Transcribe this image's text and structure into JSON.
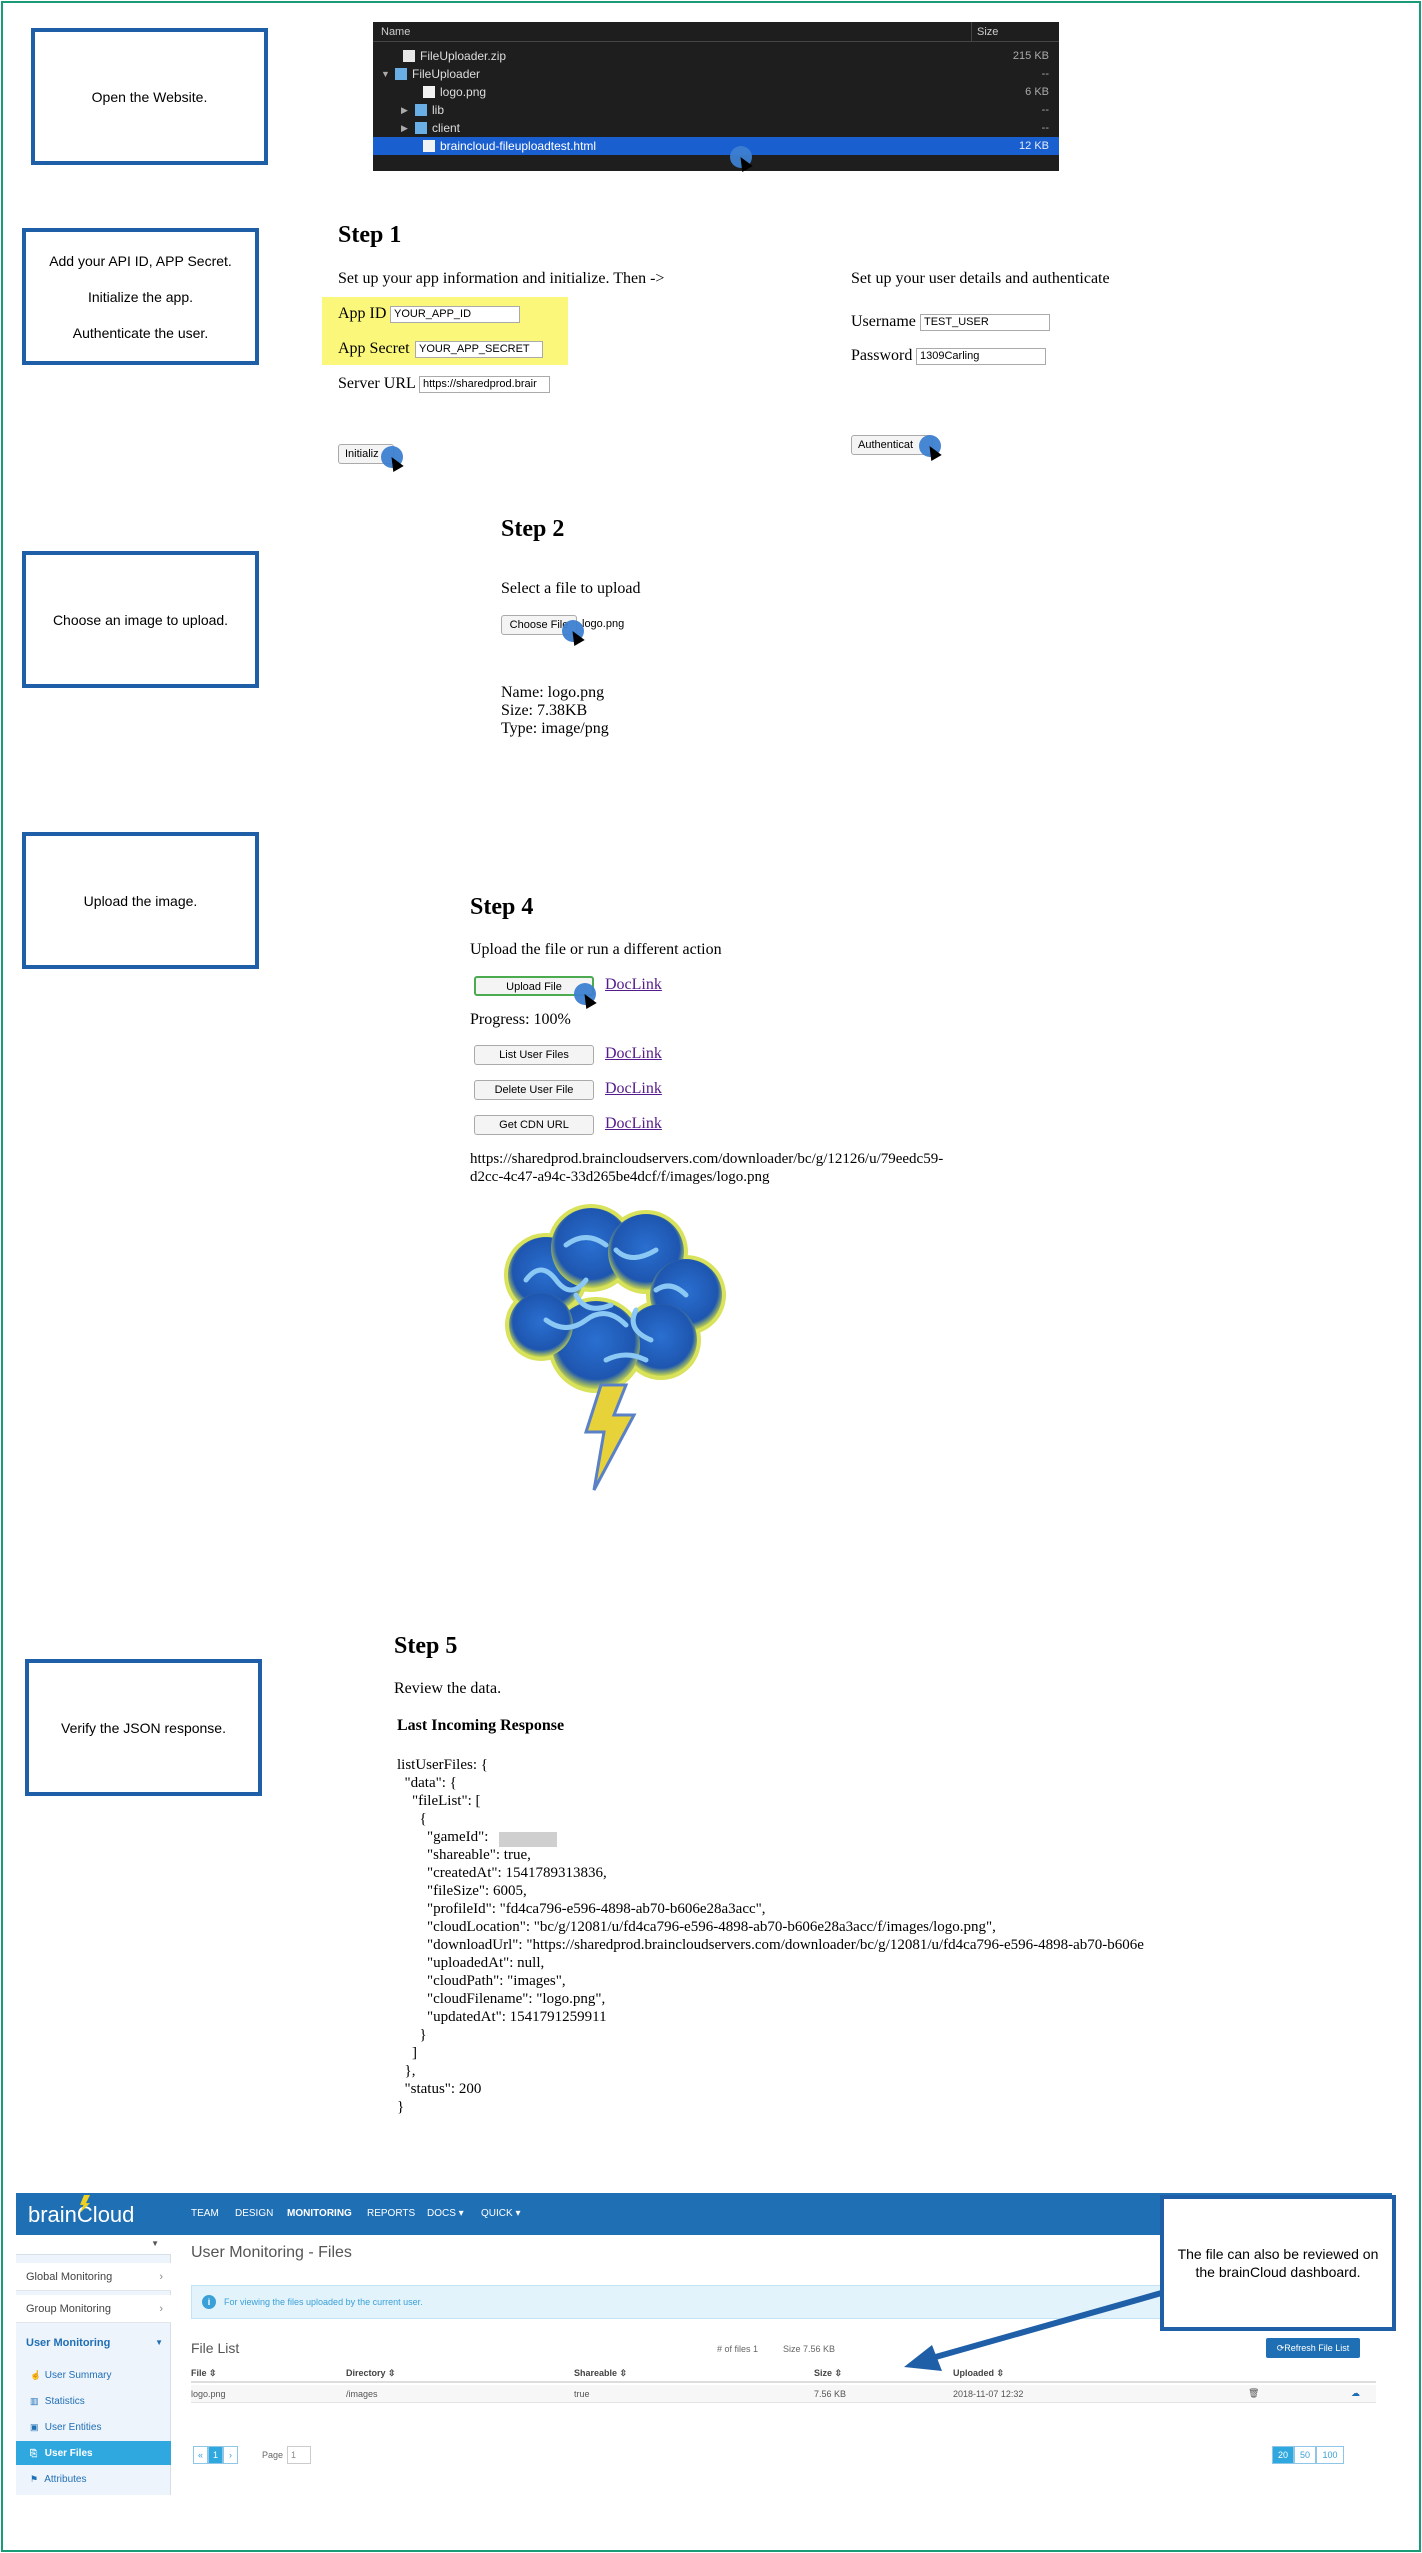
{
  "callouts": {
    "open_website": "Open the Website.",
    "add_api": [
      "Add your API ID, APP Secret.",
      "Initialize the app.",
      "Authenticate the user."
    ],
    "choose_image": "Choose an image to upload.",
    "upload_image": "Upload the image.",
    "verify_json": "Verify the JSON response.",
    "dashboard_note": "The file can also be reviewed on the brainCloud dashboard."
  },
  "finder": {
    "col_name": "Name",
    "col_size": "Size",
    "rows": [
      {
        "name": "FileUploader.zip",
        "size": "215 KB"
      },
      {
        "name": "FileUploader",
        "size": "--"
      },
      {
        "name": "logo.png",
        "size": "6 KB"
      },
      {
        "name": "lib",
        "size": "--"
      },
      {
        "name": "client",
        "size": "--"
      },
      {
        "name": "braincloud-fileuploadtest.html",
        "size": "12 KB"
      }
    ]
  },
  "step1": {
    "title": "Step 1",
    "left_instruction": "Set up your app information and initialize. Then ->",
    "right_instruction": "Set up your user details and authenticate",
    "app_id_label": "App ID",
    "app_id_value": "YOUR_APP_ID",
    "app_secret_label": "App Secret",
    "app_secret_value": "YOUR_APP_SECRET",
    "server_url_label": "Server URL",
    "server_url_value": "https://sharedprod.brair",
    "initialize_button": "Initializ",
    "username_label": "Username",
    "username_value": "TEST_USER",
    "password_label": "Password",
    "password_value": "1309Carling",
    "authenticate_button": "Authenticat"
  },
  "step2": {
    "title": "Step 2",
    "instruction": "Select a file to upload",
    "choose_file_button": "Choose File",
    "chosen_file": "logo.png",
    "name_line": "Name: logo.png",
    "size_line": "Size: 7.38KB",
    "type_line": "Type: image/png"
  },
  "step4": {
    "title": "Step 4",
    "instruction": "Upload the file or run a different action",
    "upload_button": "Upload File",
    "progress": "Progress: 100%",
    "list_button": "List User Files",
    "delete_button": "Delete User File",
    "cdn_button": "Get CDN URL",
    "doclink": "DocLink",
    "url_line1": "https://sharedprod.braincloudservers.com/downloader/bc/g/12126/u/79eedc59-",
    "url_line2": "d2cc-4c47-a94c-33d265be4dcf/f/images/logo.png"
  },
  "step5": {
    "title": "Step 5",
    "instruction": "Review the data.",
    "heading": "Last Incoming Response",
    "json_lines": [
      "listUserFiles: {",
      "  \"data\": {",
      "    \"fileList\": [",
      "      {",
      "        \"gameId\": ",
      "        \"shareable\": true,",
      "        \"createdAt\": 1541789313836,",
      "        \"fileSize\": 6005,",
      "        \"profileId\": \"fd4ca796-e596-4898-ab70-b606e28a3acc\",",
      "        \"cloudLocation\": \"bc/g/12081/u/fd4ca796-e596-4898-ab70-b606e28a3acc/f/images/logo.png\",",
      "        \"downloadUrl\": \"https://sharedprod.braincloudservers.com/downloader/bc/g/12081/u/fd4ca796-e596-4898-ab70-b606e",
      "        \"uploadedAt\": null,",
      "        \"cloudPath\": \"images\",",
      "        \"cloudFilename\": \"logo.png\",",
      "        \"updatedAt\": 1541791259911",
      "      }",
      "    ]",
      "  },",
      "  \"status\": 200",
      "}"
    ]
  },
  "dashboard": {
    "brand": "brainCloud",
    "nav": [
      "TEAM",
      "DESIGN",
      "MONITORING",
      "REPORTS",
      "DOCS ▾",
      "QUICK ▾"
    ],
    "sidebar": {
      "global": "Global Monitoring",
      "group": "Group Monitoring",
      "user": "User Monitoring",
      "subitems": [
        "User Summary",
        "Statistics",
        "User Entities",
        "User Files",
        "Attributes"
      ]
    },
    "page_title": "User Monitoring - Files",
    "info_text": "For viewing the files uploaded by the current user.",
    "file_list_title": "File List",
    "count_text": "# of files 1",
    "size_text": "Size 7.56 KB",
    "refresh_button": "Refresh File List",
    "columns": [
      "File",
      "Directory",
      "Shareable",
      "Size",
      "Uploaded"
    ],
    "row": {
      "file": "logo.png",
      "directory": "/images",
      "shareable": "true",
      "size": "7.56 KB",
      "uploaded": "2018-11-07 12:32"
    },
    "page_label": "Page",
    "page_value": "1",
    "pager": [
      "«",
      "1",
      "›"
    ],
    "page_sizes": [
      "20",
      "50",
      "100"
    ]
  }
}
